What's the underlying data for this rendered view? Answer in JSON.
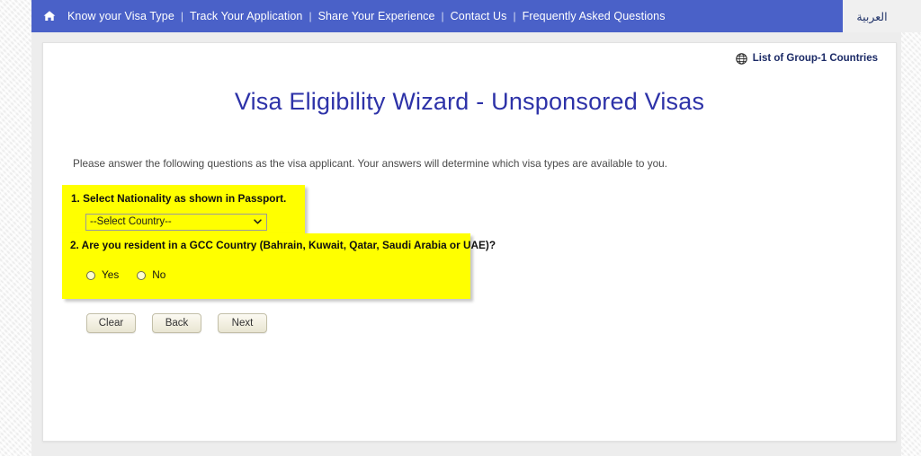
{
  "topnav": {
    "home_icon": "home-icon",
    "links": [
      "Know your Visa Type",
      "Track Your Application",
      "Share Your Experience",
      "Contact Us",
      "Frequently Asked Questions"
    ],
    "separator": "|",
    "language_label": "العربية",
    "background_color": "#4a61c8"
  },
  "header": {
    "group1_link_label": "List of Group-1 Countries",
    "group1_icon": "globe-icon",
    "title": "Visa Eligibility Wizard - Unsponsored Visas",
    "title_color": "#2d32a8"
  },
  "main": {
    "intro": "Please answer the following questions as the visa applicant. Your answers will determine which visa types are available to you.",
    "highlight_color": "#ffff00",
    "questions": [
      {
        "label": "1. Select Nationality as shown in Passport.",
        "control": "select",
        "selected_value": "--Select Country--",
        "options": [
          "--Select Country--"
        ]
      },
      {
        "label": "2. Are you resident in a GCC Country (Bahrain, Kuwait, Qatar, Saudi Arabia or UAE)?",
        "control": "radio",
        "options": [
          {
            "label": "Yes",
            "checked": false
          },
          {
            "label": "No",
            "checked": false
          }
        ]
      }
    ],
    "buttons": [
      {
        "label": "Clear"
      },
      {
        "label": "Back"
      },
      {
        "label": "Next"
      }
    ]
  }
}
